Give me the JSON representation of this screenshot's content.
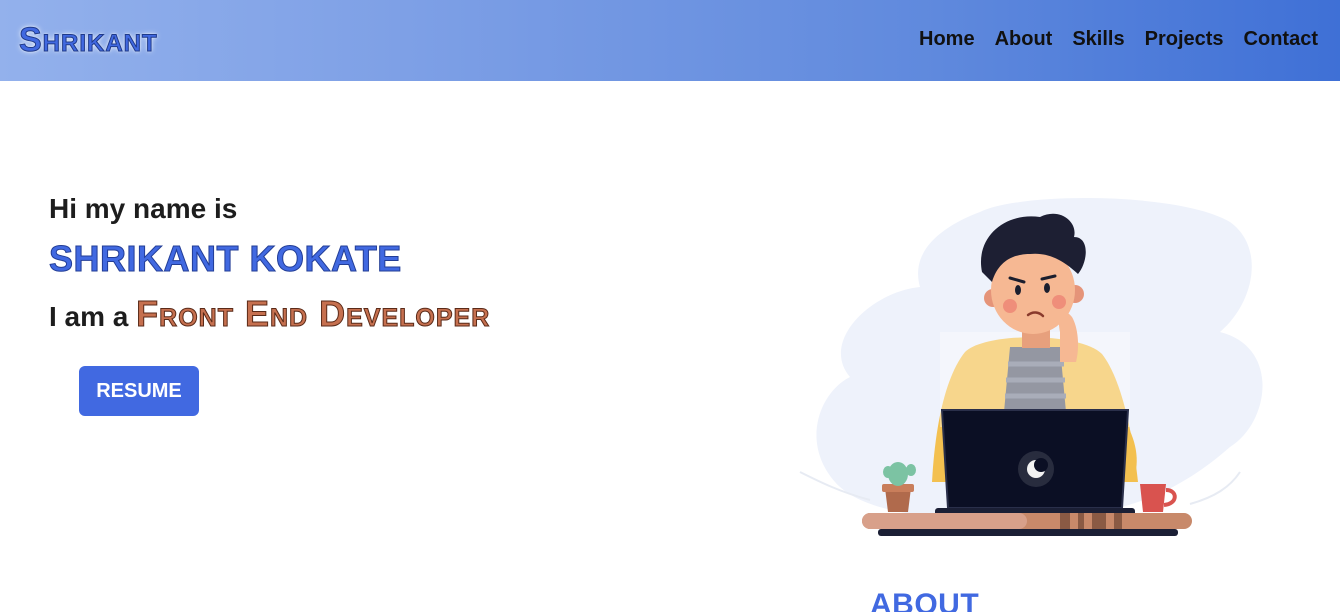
{
  "brand": {
    "name": "Shrikant"
  },
  "nav": {
    "items": [
      {
        "label": "Home"
      },
      {
        "label": "About"
      },
      {
        "label": "Skills"
      },
      {
        "label": "Projects"
      },
      {
        "label": "Contact"
      }
    ]
  },
  "hero": {
    "greeting": "Hi my name is",
    "name": "SHRIKANT KOKATE",
    "role_prefix": "I am a",
    "role": "Front End Developer",
    "resume_label": "RESUME",
    "illustration_icon": "developer-at-laptop-illustration"
  },
  "about": {
    "heading": "ABOUT"
  },
  "colors": {
    "accent": "#4169e1",
    "role_color": "#c6704f",
    "nav_gradient_start": "#93b1ec",
    "nav_gradient_end": "#3f70d6"
  }
}
